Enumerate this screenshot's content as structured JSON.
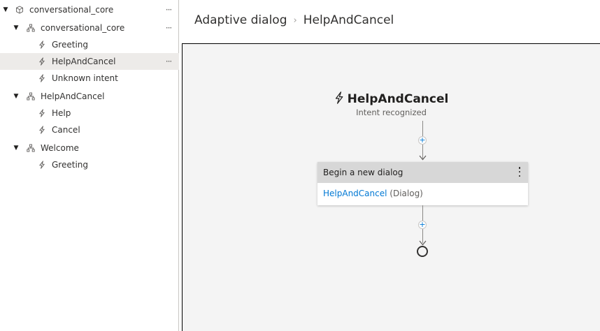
{
  "tree": {
    "root": {
      "label": "conversational_core",
      "more": "···"
    },
    "groups": [
      {
        "label": "conversational_core",
        "more": "···",
        "items": [
          {
            "label": "Greeting"
          },
          {
            "label": "HelpAndCancel",
            "more": "···"
          },
          {
            "label": "Unknown intent"
          }
        ]
      },
      {
        "label": "HelpAndCancel",
        "items": [
          {
            "label": "Help"
          },
          {
            "label": "Cancel"
          }
        ]
      },
      {
        "label": "Welcome",
        "items": [
          {
            "label": "Greeting"
          }
        ]
      }
    ]
  },
  "header": {
    "breadcrumb": [
      "Adaptive dialog",
      "HelpAndCancel"
    ],
    "separator": "›"
  },
  "canvas": {
    "trigger": {
      "title": "HelpAndCancel",
      "subtitle": "Intent recognized"
    },
    "add_symbol": "+",
    "action_card": {
      "header": "Begin a new dialog",
      "dialog_link": "HelpAndCancel",
      "dialog_type": "(Dialog)"
    }
  },
  "colors": {
    "accent": "#0078d4",
    "selected_row": "#edebe9",
    "canvas_bg": "#f4f4f4",
    "card_header": "#d7d7d7"
  },
  "icons": {
    "root": "cube-icon",
    "dialog": "dialog-tree-icon",
    "trigger": "lightning-bolt-icon",
    "expand": "caret-down-icon"
  }
}
